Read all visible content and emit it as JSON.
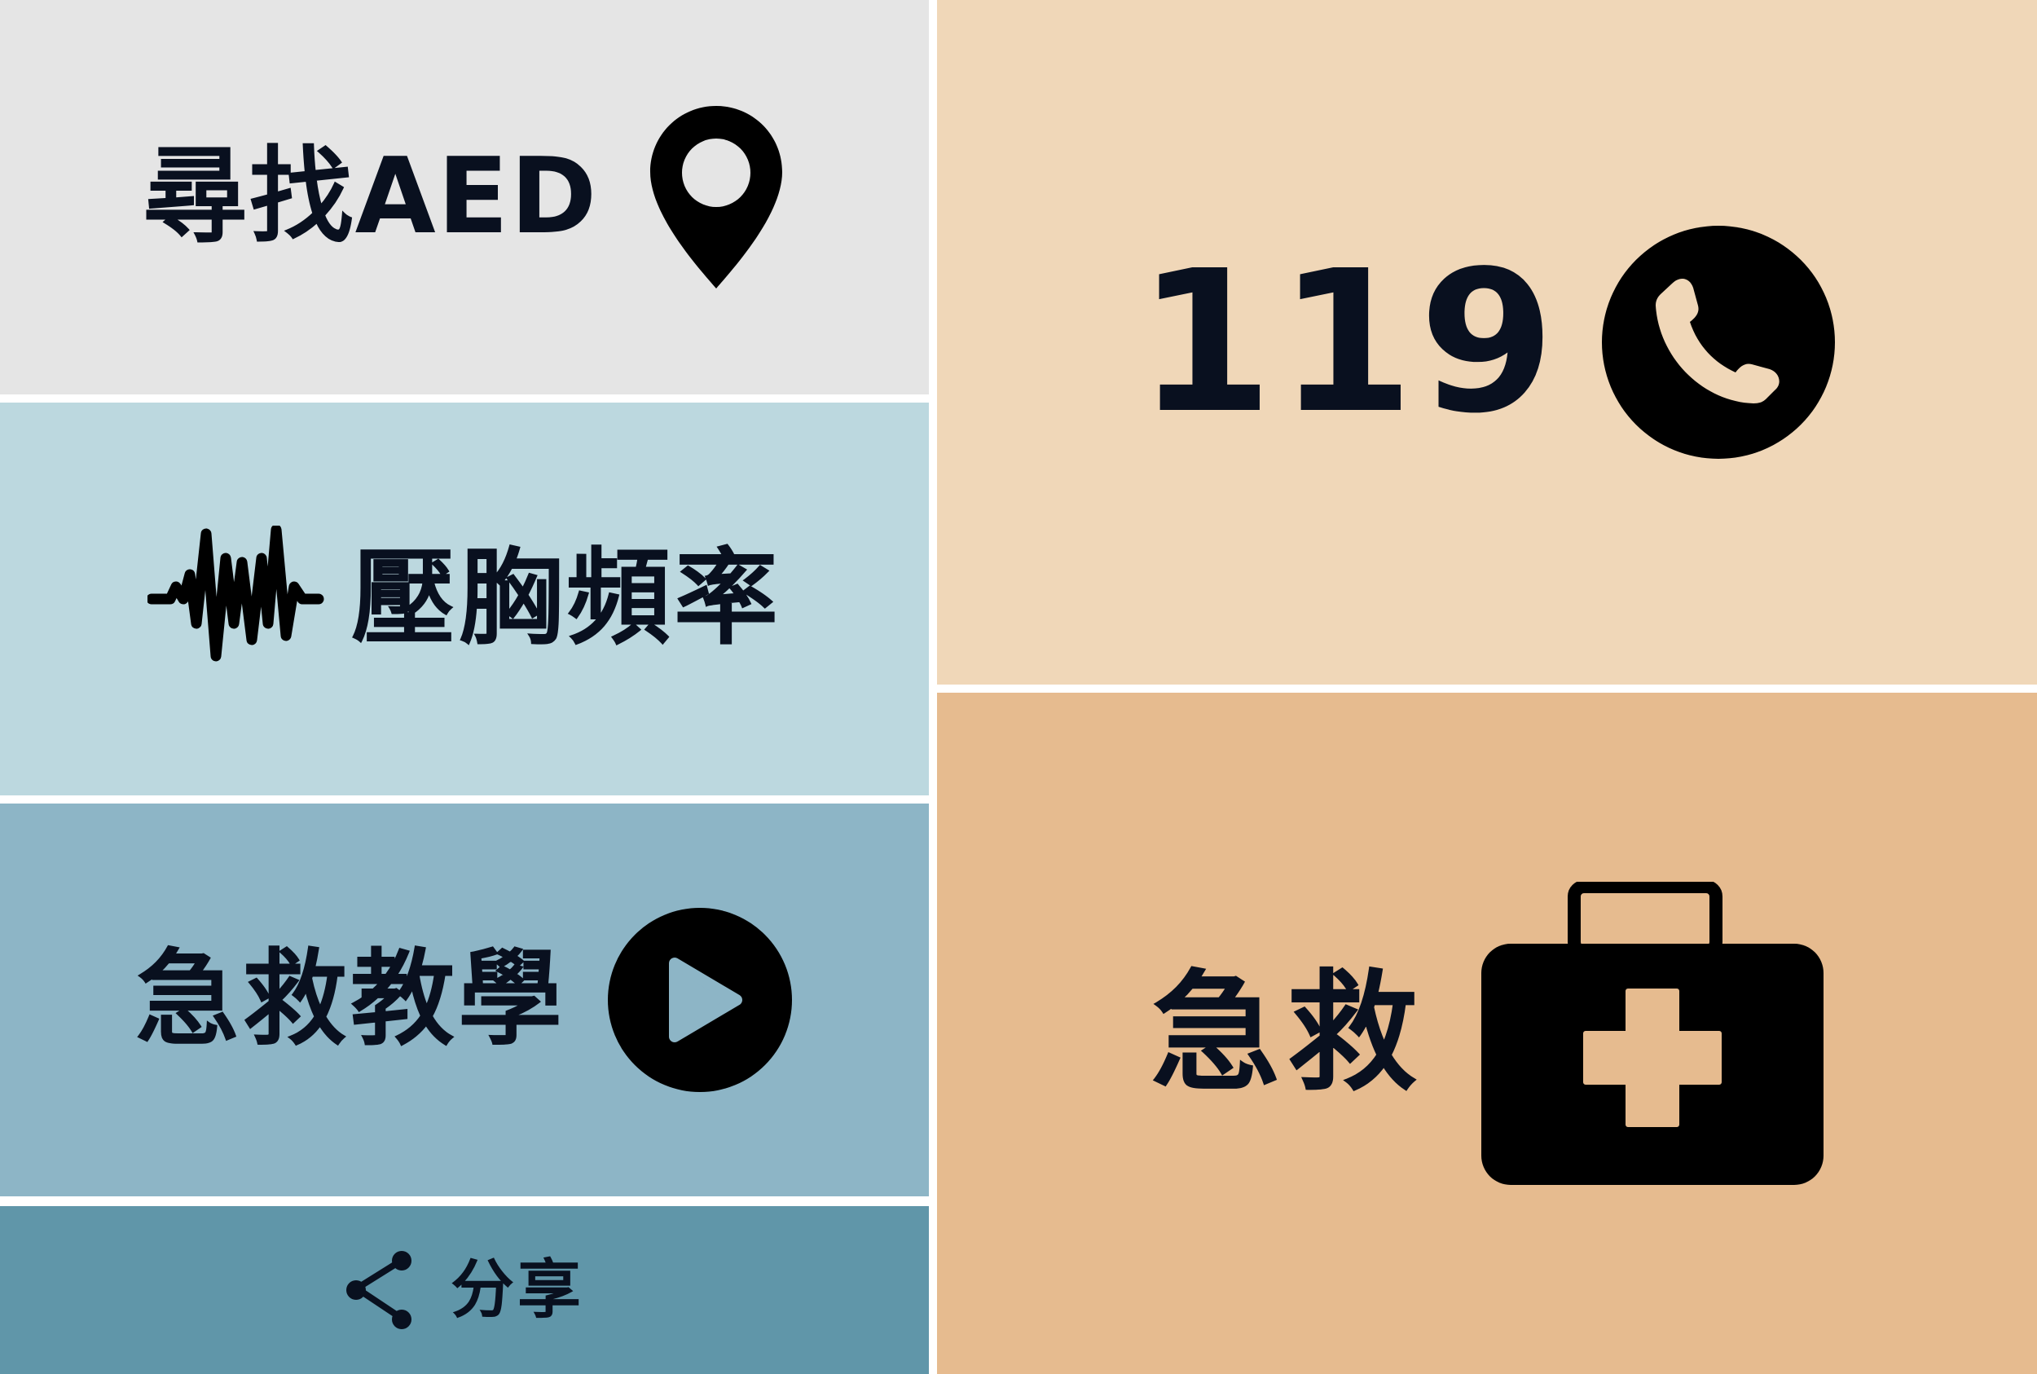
{
  "tiles": {
    "find_aed": {
      "label": "尋找AED",
      "icon": "map-pin-icon",
      "bg": "#e5e5e5"
    },
    "compression_rate": {
      "label": "壓胸頻率",
      "icon": "heartbeat-wave-icon",
      "bg": "#bcd8df"
    },
    "first_aid_tutorial": {
      "label": "急救教學",
      "icon": "play-circle-icon",
      "bg": "#8db5c6"
    },
    "share": {
      "label": "分享",
      "icon": "share-icon",
      "bg": "#6096a9"
    },
    "call_119": {
      "label": "119",
      "icon": "phone-circle-icon",
      "bg": "#f0d7b8"
    },
    "first_aid": {
      "label": "急救",
      "icon": "first-aid-kit-icon",
      "bg": "#e6bb8f"
    }
  },
  "colors": {
    "text": "#09101f",
    "gap": "#ffffff"
  }
}
